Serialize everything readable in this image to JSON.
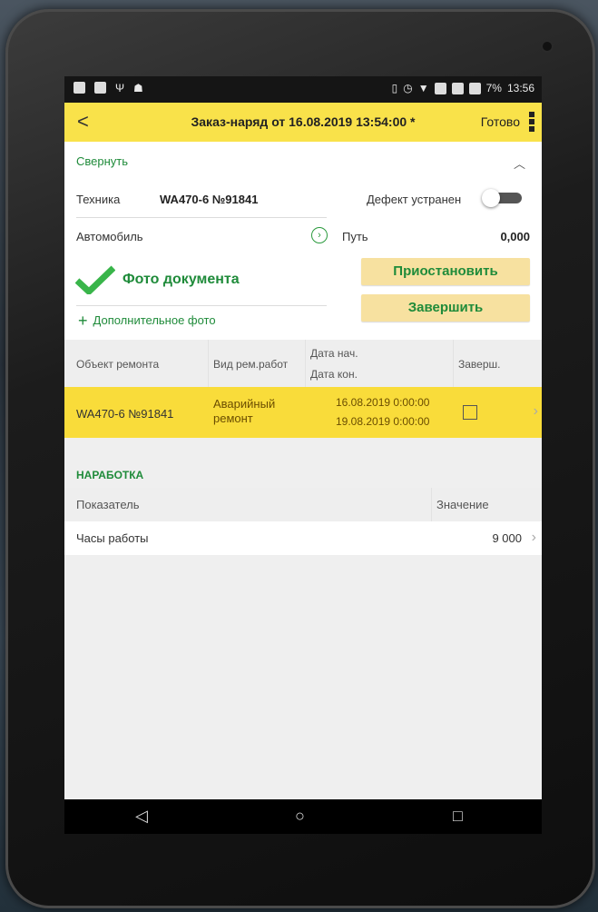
{
  "statusbar": {
    "battery_percent": "7%",
    "time": "13:56",
    "left_icons": [
      "notification-icon",
      "gallery-icon",
      "usb-icon",
      "android-debug-icon"
    ],
    "right_icons": [
      "vibrate-icon",
      "alarm-icon",
      "wifi-icon",
      "signal-icon",
      "signal-icon",
      "battery-icon"
    ]
  },
  "header": {
    "back_glyph": "<",
    "title": "Заказ-наряд  от 16.08.2019 13:54:00 *",
    "done": "Готово"
  },
  "form": {
    "collapse": "Свернуть",
    "equipment_label": "Техника",
    "equipment_value": "WA470-6 №91841",
    "defect_label": "Дефект устранен",
    "defect_fixed": false,
    "car_label": "Автомобиль",
    "path_label": "Путь",
    "path_value": "0,000",
    "photo_label": "Фото документа",
    "add_photo": "Дополнительное фото",
    "pause_button": "Приостановить",
    "finish_button": "Завершить"
  },
  "repair_table": {
    "headers": {
      "object": "Объект ремонта",
      "work_type": "Вид рем.работ",
      "date_start": "Дата нач.",
      "date_end": "Дата кон.",
      "completed": "Заверш."
    },
    "rows": [
      {
        "object": "WA470-6 №91841",
        "work_type_line1": "Аварийный",
        "work_type_line2": "ремонт",
        "date_start": "16.08.2019 0:00:00",
        "date_end": "19.08.2019 0:00:00",
        "completed": false
      }
    ]
  },
  "operating": {
    "section_title": "НАРАБОТКА",
    "headers": {
      "indicator": "Показатель",
      "value": "Значение"
    },
    "rows": [
      {
        "indicator": "Часы работы",
        "value": "9 000"
      }
    ]
  },
  "colors": {
    "accent_yellow": "#f9e24a",
    "row_yellow": "#f9dc3a",
    "button_bg": "#f7e1a0",
    "green": "#1f8b3a"
  }
}
